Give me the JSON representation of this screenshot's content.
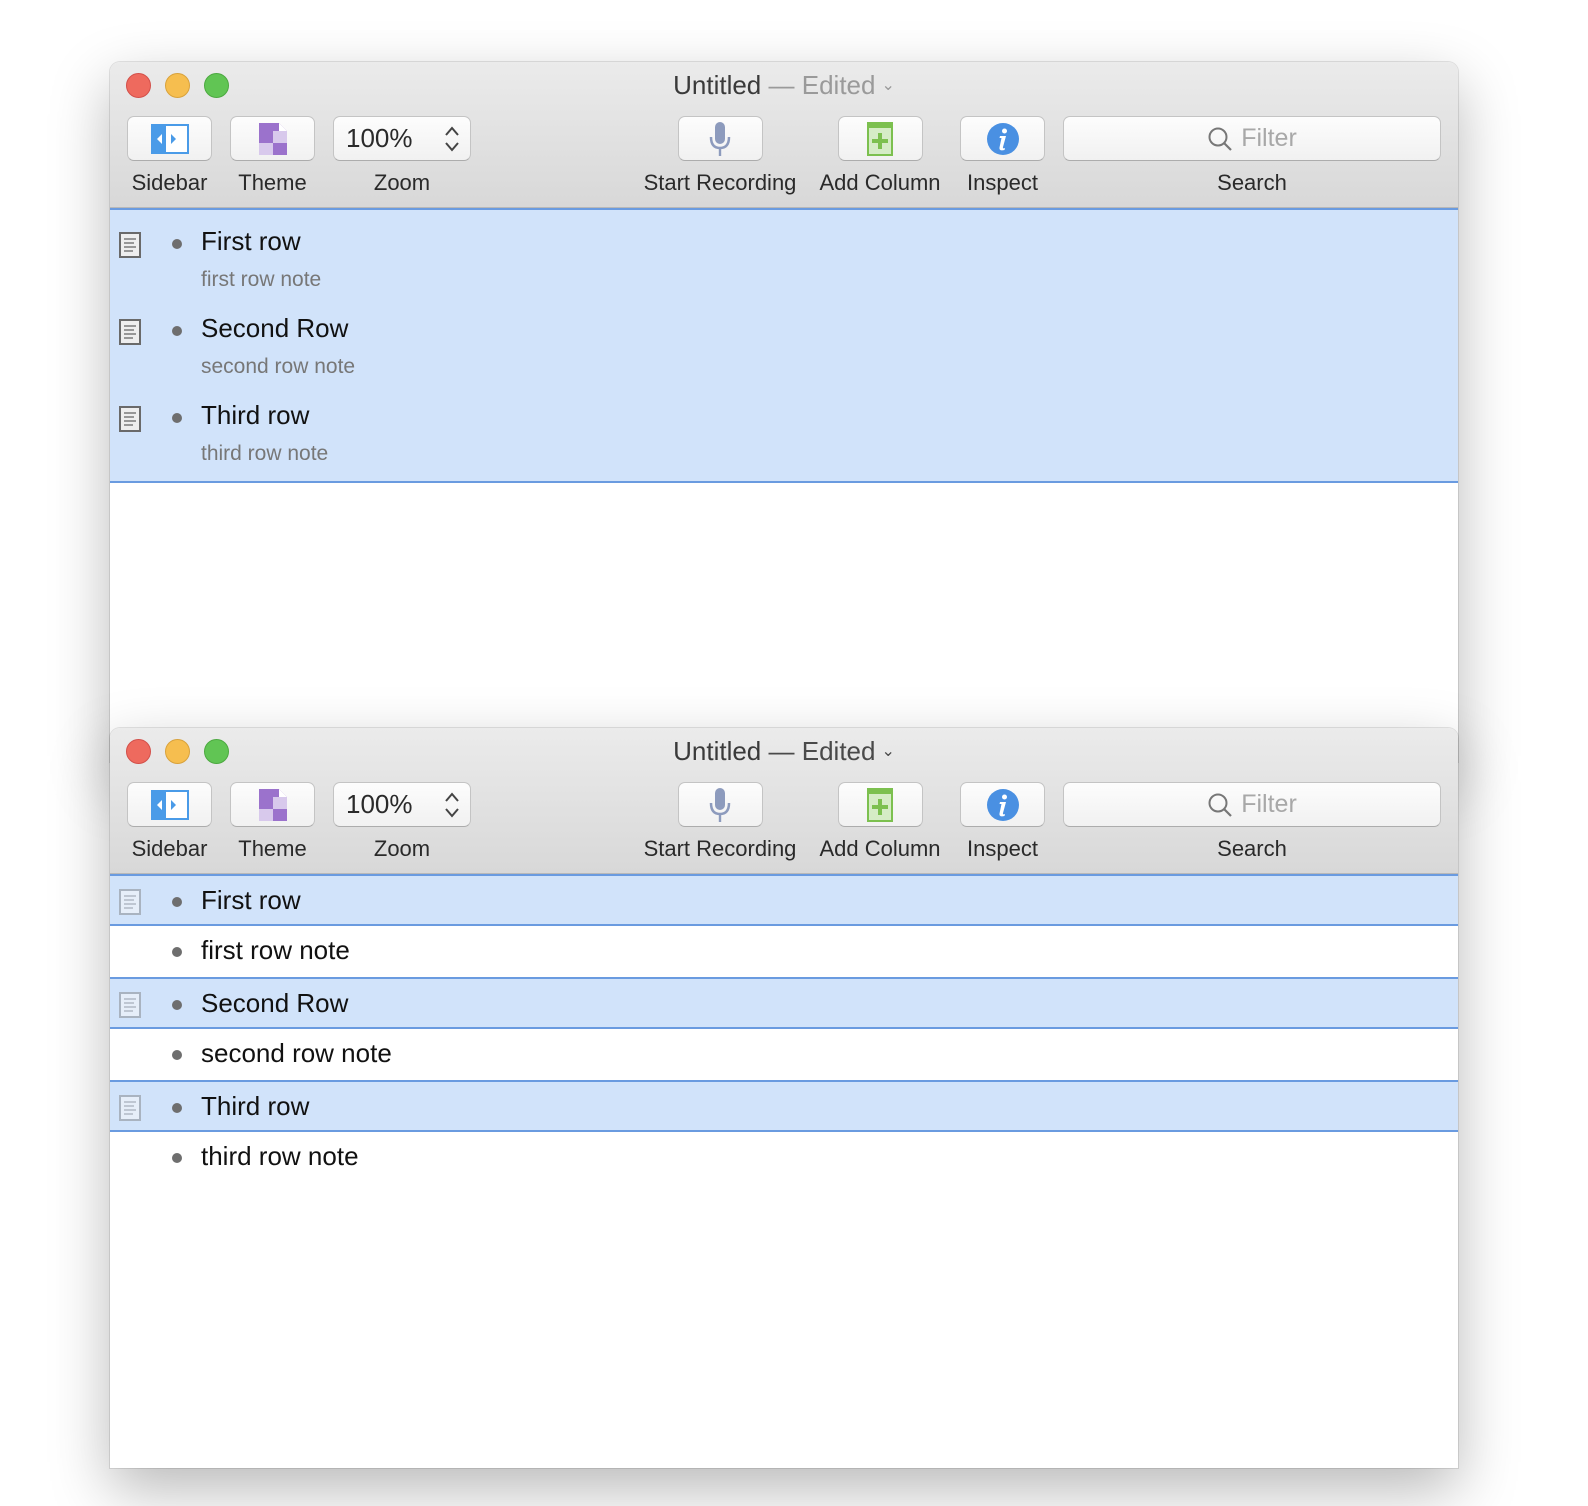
{
  "colors": {
    "selection_bg": "#d1e3fa",
    "selection_border": "#6a9be0",
    "close": "#ee6a5e",
    "minimize": "#f6be4f",
    "maximize": "#61c554",
    "sidebar_icon": "#4a9be8",
    "theme_icon": "#9b72cc",
    "mic_icon": "#8d9bbd",
    "add_column_icon": "#7cc04f",
    "inspect_icon": "#4a90e2"
  },
  "windows": [
    {
      "title": "Untitled",
      "separator": "—",
      "status": "Edited",
      "toolbar": {
        "sidebar": {
          "label": "Sidebar",
          "icon": "sidebar-icon"
        },
        "theme": {
          "label": "Theme",
          "icon": "theme-icon"
        },
        "zoom": {
          "label": "Zoom",
          "value": "100%",
          "icon": "stepper-icon"
        },
        "record": {
          "label": "Start Recording",
          "icon": "microphone-icon"
        },
        "add_column": {
          "label": "Add Column",
          "icon": "add-column-icon"
        },
        "inspect": {
          "label": "Inspect",
          "icon": "info-icon"
        },
        "search": {
          "label": "Search",
          "placeholder": "Filter",
          "icon": "search-icon"
        }
      },
      "rows": [
        {
          "title": "First row",
          "note": "first row note"
        },
        {
          "title": "Second Row",
          "note": "second row note"
        },
        {
          "title": "Third row",
          "note": "third row note"
        }
      ]
    },
    {
      "title": "Untitled",
      "separator": "—",
      "status": "Edited",
      "toolbar": {
        "sidebar": {
          "label": "Sidebar",
          "icon": "sidebar-icon"
        },
        "theme": {
          "label": "Theme",
          "icon": "theme-icon"
        },
        "zoom": {
          "label": "Zoom",
          "value": "100%",
          "icon": "stepper-icon"
        },
        "record": {
          "label": "Start Recording",
          "icon": "microphone-icon"
        },
        "add_column": {
          "label": "Add Column",
          "icon": "add-column-icon"
        },
        "inspect": {
          "label": "Inspect",
          "icon": "info-icon"
        },
        "search": {
          "label": "Search",
          "placeholder": "Filter",
          "icon": "search-icon"
        }
      },
      "rows": [
        {
          "title": "First row",
          "note": "first row note"
        },
        {
          "title": "Second Row",
          "note": "second row note"
        },
        {
          "title": "Third row",
          "note": "third row note"
        }
      ]
    }
  ]
}
